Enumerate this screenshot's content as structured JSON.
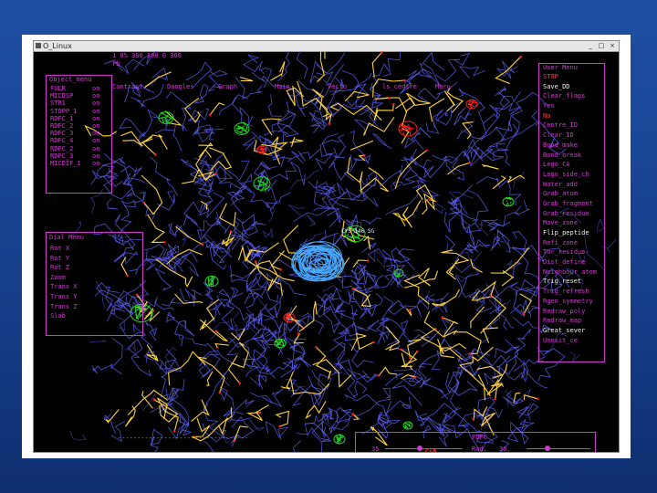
{
  "window": {
    "title": "O_Linux",
    "buttons": [
      "_",
      "□",
      "×"
    ]
  },
  "top_info": {
    "line1": "1 0% 360 300 0 360",
    "line2": "rb"
  },
  "toolbar": [
    "Contrast",
    "Dangles",
    "Graph",
    "Main",
    "Vecto",
    "ls_centre",
    "Meru"
  ],
  "object_menu": {
    "title": "Object_menu",
    "items": [
      {
        "name": "FULR",
        "state": "on"
      },
      {
        "name": "MICDSP",
        "state": "on"
      },
      {
        "name": "STR1",
        "state": "on"
      },
      {
        "name": "STOPP_1",
        "state": "on"
      },
      {
        "name": "RDFC_1",
        "state": "on"
      },
      {
        "name": "RDFC_2",
        "state": "on"
      },
      {
        "name": "RDFC_3",
        "state": "on"
      },
      {
        "name": "RDFC_4",
        "state": "on"
      },
      {
        "name": "RDFC_2",
        "state": "on"
      },
      {
        "name": "RDFC_3",
        "state": "on"
      },
      {
        "name": "MICDIF_1",
        "state": "on"
      }
    ]
  },
  "dial_menu": {
    "title": "Dial Menu",
    "items": [
      "Rot X",
      "Rot Y",
      "Rot Z",
      "Zoom",
      "Trans X",
      "Trans Y",
      "Trans Z",
      "Slab"
    ]
  },
  "user_menu": {
    "title": "User Menu",
    "items": [
      {
        "label": "STOP",
        "tone": "red"
      },
      {
        "label": "Save_DD",
        "tone": "white"
      },
      {
        "label": "Clear_flags",
        "tone": "magenta"
      },
      {
        "label": "Yes",
        "tone": "magenta"
      },
      {
        "label": "No",
        "tone": "red"
      },
      {
        "label": "Centre_ID",
        "tone": "magenta"
      },
      {
        "label": "Clear_ID",
        "tone": "magenta"
      },
      {
        "label": "Bond_make",
        "tone": "magenta"
      },
      {
        "label": "Bond_break",
        "tone": "magenta"
      },
      {
        "label": "Lego_CA",
        "tone": "magenta"
      },
      {
        "label": "Lego_side_ch",
        "tone": "magenta"
      },
      {
        "label": "Water_add",
        "tone": "magenta"
      },
      {
        "label": "Grab_atom",
        "tone": "magenta"
      },
      {
        "label": "Grab_fragment",
        "tone": "magenta"
      },
      {
        "label": "Grab_residue",
        "tone": "magenta"
      },
      {
        "label": "Move_zone",
        "tone": "magenta"
      },
      {
        "label": "Flip_peptide",
        "tone": "white"
      },
      {
        "label": "Refi_zone",
        "tone": "magenta"
      },
      {
        "label": "Tor_residue",
        "tone": "magenta"
      },
      {
        "label": "Dist_define",
        "tone": "magenta"
      },
      {
        "label": "Neighbour_atom",
        "tone": "magenta"
      },
      {
        "label": "Trig_reset",
        "tone": "white"
      },
      {
        "label": "Trig_refresh",
        "tone": "magenta"
      },
      {
        "label": "Rgen_symmetry",
        "tone": "magenta"
      },
      {
        "label": "Redraw_poly",
        "tone": "magenta"
      },
      {
        "label": "Redraw_map",
        "tone": "magenta"
      },
      {
        "label": "Great_sever",
        "tone": "white"
      },
      {
        "label": "Unexit_ce",
        "tone": "magenta"
      }
    ]
  },
  "atom_label": "CYS 146 SG",
  "bottom_bar": {
    "left_value": "35",
    "fdfc_label": "FDFC",
    "rad_label": "Rad.",
    "rad_value": "30."
  },
  "colors": {
    "menu": "#d03ad0",
    "density": "#5a5ff0",
    "difference_pos": "#1fdc1f",
    "difference_neg": "#ff2020",
    "model": "#ffd23a",
    "focus_density": "#4aa8ff"
  }
}
